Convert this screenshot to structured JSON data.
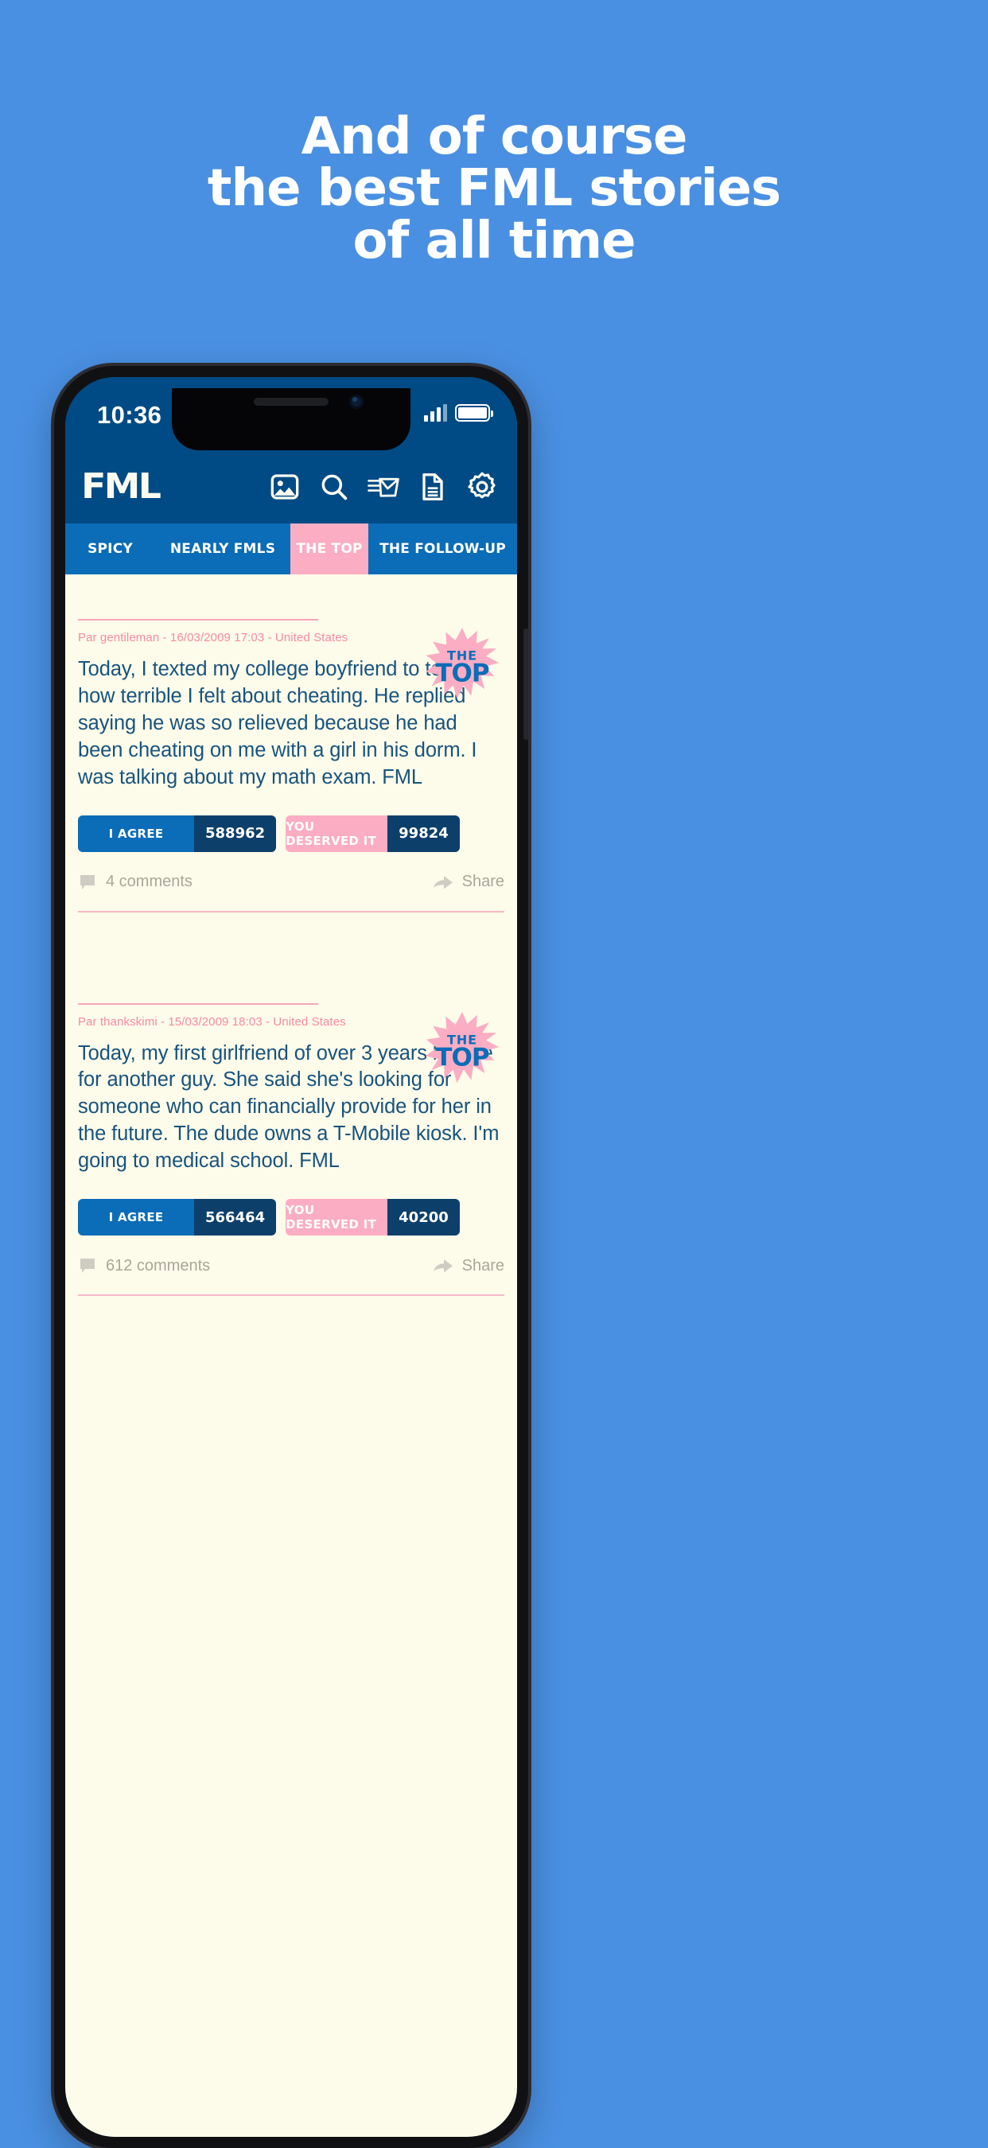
{
  "promo": {
    "lines": [
      "And of course",
      "the best FML stories",
      "of all time"
    ],
    "bg_color": "#4a90e2",
    "text_color": "#ffffff"
  },
  "status_bar": {
    "time": "10:36",
    "signal_icon": "cellular-signal-icon",
    "battery_icon": "battery-icon"
  },
  "app_header": {
    "logo": "FML",
    "bg_color": "#004b85",
    "icons": [
      {
        "name": "image-icon",
        "label": "Images"
      },
      {
        "name": "search-icon",
        "label": "Search"
      },
      {
        "name": "mail-icon",
        "label": "Mail"
      },
      {
        "name": "document-icon",
        "label": "Articles"
      },
      {
        "name": "gear-icon",
        "label": "Settings"
      }
    ]
  },
  "tabs": {
    "active": "THE TOP",
    "active_color": "#fbadc3",
    "bar_color": "#0b6cb8",
    "items": [
      {
        "label": "SPICY",
        "active": false
      },
      {
        "label": "NEARLY FMLS",
        "active": false
      },
      {
        "label": "THE TOP",
        "active": true
      },
      {
        "label": "THE FOLLOW-UP",
        "active": false
      }
    ]
  },
  "feed": {
    "bg_color": "#fdfbe9",
    "badge_label_top": "THE",
    "badge_label_bottom": "TOP",
    "posts": [
      {
        "byline": "Par gentileman - 16/03/2009 17:03 - United States",
        "text": "Today, I texted my college boyfriend to tell him how terrible I felt about cheating. He replied saying he was so relieved because he had been cheating on me with a girl in his dorm. I was talking about my math exam. FML",
        "agree_label": "I AGREE",
        "agree_count": "588962",
        "deserved_label": "YOU DESERVED IT",
        "deserved_count": "99824",
        "comments": "4 comments",
        "share": "Share"
      },
      {
        "byline": "Par thankskimi - 15/03/2009 18:03 - United States",
        "text": "Today, my first girlfriend of over 3 years left me for another guy. She said she's looking for someone who can financially provide for her in the future. The dude owns a T-Mobile kiosk. I'm going to medical school. FML",
        "agree_label": "I AGREE",
        "agree_count": "566464",
        "deserved_label": "YOU DESERVED IT",
        "deserved_count": "40200",
        "comments": "612 comments",
        "share": "Share"
      }
    ]
  },
  "colors": {
    "brand_blue": "#004b85",
    "tab_blue": "#0b6cb8",
    "pink": "#fbadc3",
    "cream": "#fdfbe9",
    "body_text": "#17547f",
    "byline_pink": "#f58aa6",
    "count_navy": "#0d3f6b"
  }
}
